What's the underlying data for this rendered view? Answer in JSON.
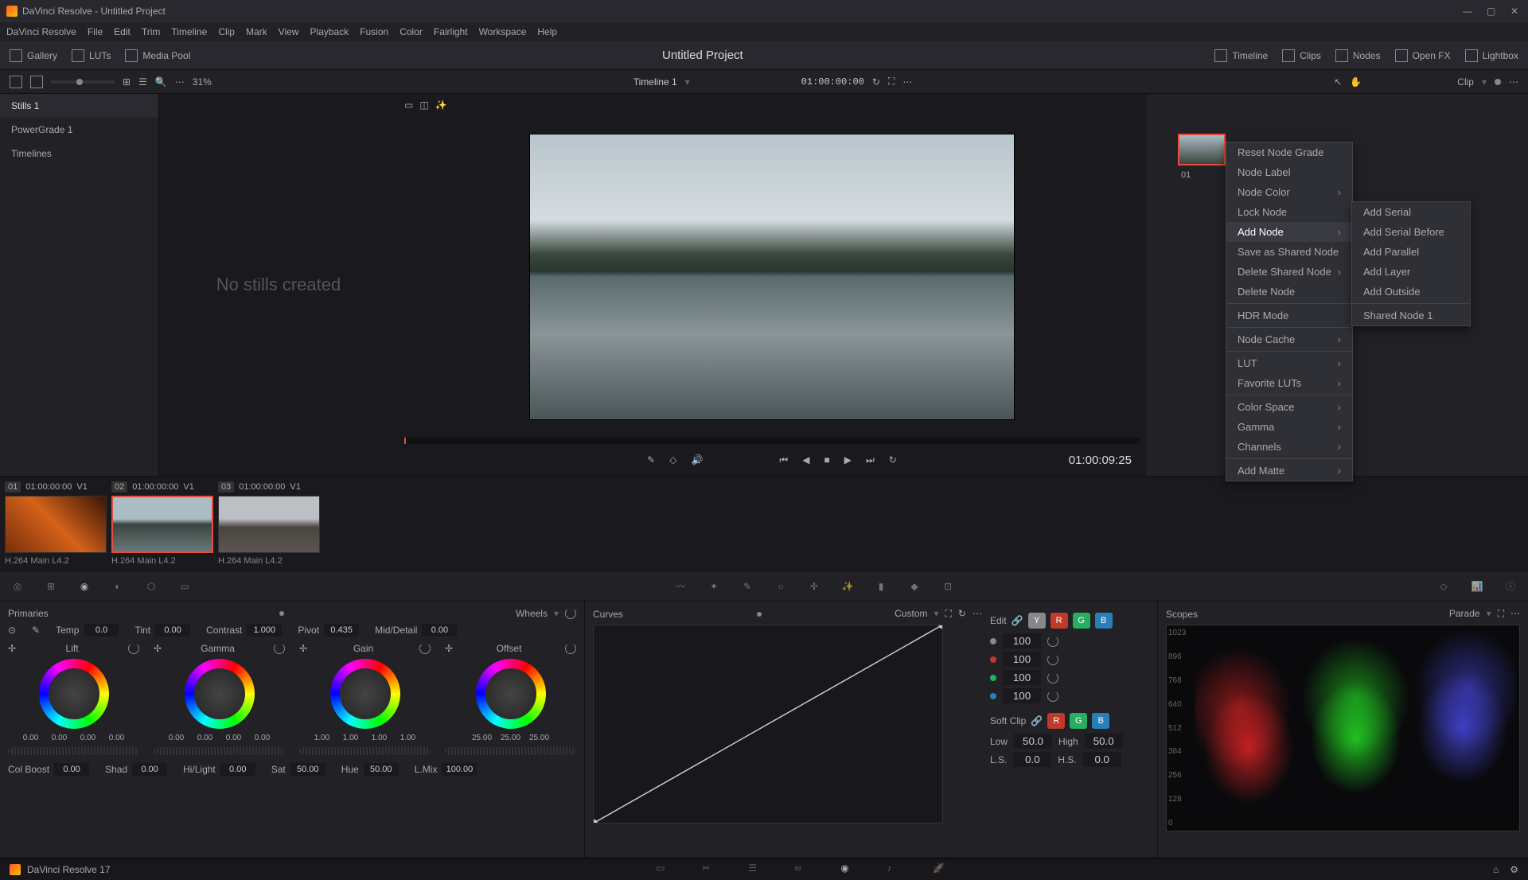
{
  "titlebar": {
    "title": "DaVinci Resolve - Untitled Project"
  },
  "menubar": [
    "DaVinci Resolve",
    "File",
    "Edit",
    "Trim",
    "Timeline",
    "Clip",
    "Mark",
    "View",
    "Playback",
    "Fusion",
    "Color",
    "Fairlight",
    "Workspace",
    "Help"
  ],
  "top_toolbar": {
    "left": [
      {
        "name": "gallery",
        "label": "Gallery"
      },
      {
        "name": "luts",
        "label": "LUTs"
      },
      {
        "name": "media-pool",
        "label": "Media Pool"
      }
    ],
    "project": "Untitled Project",
    "right": [
      {
        "name": "timeline",
        "label": "Timeline"
      },
      {
        "name": "clips",
        "label": "Clips"
      },
      {
        "name": "nodes",
        "label": "Nodes"
      },
      {
        "name": "openfx",
        "label": "Open FX"
      },
      {
        "name": "lightbox",
        "label": "Lightbox"
      }
    ]
  },
  "sec_toolbar": {
    "zoom": "31%",
    "timeline_name": "Timeline 1",
    "timecode": "01:00:00:00",
    "clip_label": "Clip"
  },
  "stills": {
    "tabs": [
      "Stills 1",
      "PowerGrade 1",
      "Timelines"
    ],
    "empty": "No stills created"
  },
  "viewer": {
    "timecode": "01:00:09:25"
  },
  "node": {
    "id": "01"
  },
  "context_menu": {
    "items": [
      {
        "label": "Reset Node Grade"
      },
      {
        "label": "Node Label"
      },
      {
        "label": "Node Color",
        "arrow": true
      },
      {
        "label": "Lock Node"
      },
      {
        "label": "Add Node",
        "arrow": true,
        "hl": true
      },
      {
        "label": "Save as Shared Node"
      },
      {
        "label": "Delete Shared Node",
        "arrow": true
      },
      {
        "label": "Delete Node"
      },
      {
        "sep": true
      },
      {
        "label": "HDR Mode"
      },
      {
        "sep": true
      },
      {
        "label": "Node Cache",
        "arrow": true
      },
      {
        "sep": true
      },
      {
        "label": "LUT",
        "arrow": true
      },
      {
        "label": "Favorite LUTs",
        "arrow": true
      },
      {
        "sep": true
      },
      {
        "label": "Color Space",
        "arrow": true
      },
      {
        "label": "Gamma",
        "arrow": true
      },
      {
        "label": "Channels",
        "arrow": true
      },
      {
        "sep": true
      },
      {
        "label": "Add Matte",
        "arrow": true
      }
    ],
    "submenu": [
      "Add Serial",
      "Add Serial Before",
      "Add Parallel",
      "Add Layer",
      "Add Outside",
      "",
      "Shared Node 1"
    ]
  },
  "clips": [
    {
      "num": "01",
      "tc": "01:00:00:00",
      "track": "V1",
      "label": "H.264 Main L4.2",
      "cls": "c1"
    },
    {
      "num": "02",
      "tc": "01:00:00:00",
      "track": "V1",
      "label": "H.264 Main L4.2",
      "cls": "c2",
      "sel": true
    },
    {
      "num": "03",
      "tc": "01:00:00:00",
      "track": "V1",
      "label": "H.264 Main L4.2",
      "cls": "c3"
    }
  ],
  "primaries": {
    "title": "Primaries",
    "mode": "Wheels",
    "params": {
      "temp": "0.0",
      "tint": "0.00",
      "contrast": "1.000",
      "pivot": "0.435",
      "middetail": "0.00"
    },
    "wheels": [
      {
        "name": "Lift",
        "vals": [
          "0.00",
          "0.00",
          "0.00",
          "0.00"
        ]
      },
      {
        "name": "Gamma",
        "vals": [
          "0.00",
          "0.00",
          "0.00",
          "0.00"
        ]
      },
      {
        "name": "Gain",
        "vals": [
          "1.00",
          "1.00",
          "1.00",
          "1.00"
        ]
      },
      {
        "name": "Offset",
        "vals": [
          "25.00",
          "25.00",
          "25.00"
        ]
      }
    ],
    "bottom": {
      "colboost": "0.00",
      "shad": "0.00",
      "hilight": "0.00",
      "sat": "50.00",
      "hue": "50.00",
      "lmix": "100.00"
    }
  },
  "curves": {
    "title": "Curves",
    "mode": "Custom",
    "edit": "Edit",
    "vals": [
      "100",
      "100",
      "100",
      "100"
    ],
    "softclip": "Soft Clip",
    "low": "50.0",
    "high": "50.0",
    "ls": "0.0",
    "hs": "0.0",
    "low_lbl": "Low",
    "high_lbl": "High",
    "ls_lbl": "L.S.",
    "hs_lbl": "H.S."
  },
  "scopes": {
    "title": "Scopes",
    "mode": "Parade",
    "labels": [
      "1023",
      "896",
      "768",
      "640",
      "512",
      "384",
      "256",
      "128",
      "0"
    ]
  },
  "statusbar": {
    "version": "DaVinci Resolve 17"
  }
}
